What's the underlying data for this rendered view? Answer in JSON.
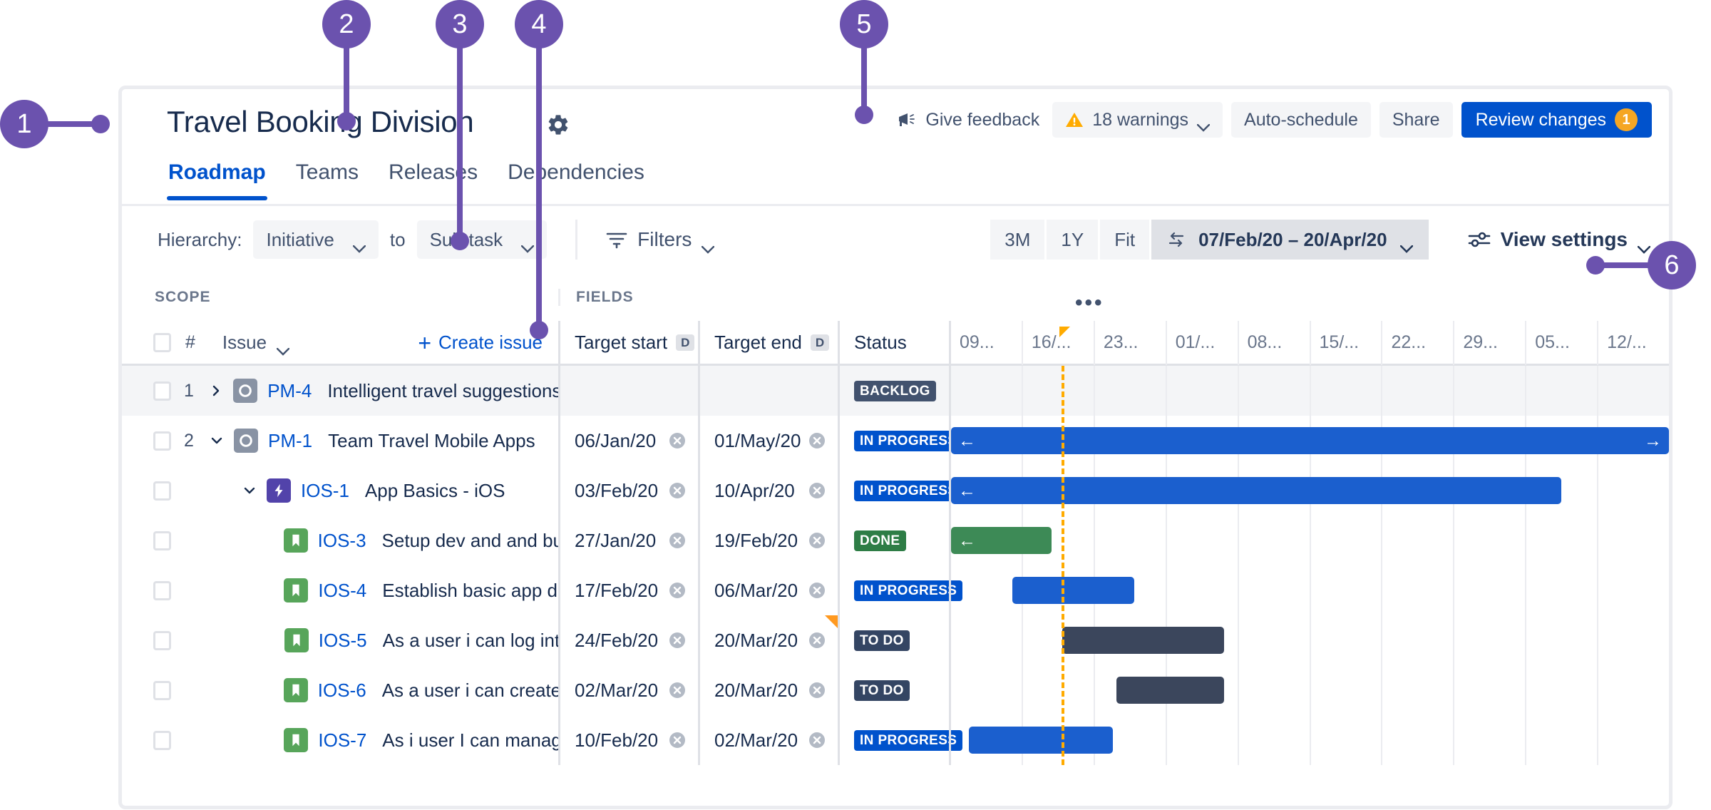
{
  "header": {
    "title": "Travel Booking Division",
    "settings_icon": "gear-icon",
    "give_feedback": "Give feedback",
    "warnings_label": "18 warnings",
    "auto_schedule": "Auto-schedule",
    "share": "Share",
    "review_changes": "Review changes",
    "review_changes_count": "1"
  },
  "tabs": [
    {
      "label": "Roadmap",
      "active": true
    },
    {
      "label": "Teams",
      "active": false
    },
    {
      "label": "Releases",
      "active": false
    },
    {
      "label": "Dependencies",
      "active": false
    }
  ],
  "toolbar": {
    "hierarchy_label": "Hierarchy:",
    "hierarchy_from": "Initiative",
    "hierarchy_to_word": "to",
    "hierarchy_to": "Sub-task",
    "filters_label": "Filters",
    "zoom_3m": "3M",
    "zoom_1y": "1Y",
    "zoom_fit": "Fit",
    "date_range": "07/Feb/20 – 20/Apr/20",
    "view_settings": "View settings"
  },
  "grid": {
    "scope_header": "SCOPE",
    "fields_header": "FIELDS",
    "more_menu": "•••",
    "hash_col": "#",
    "issue_col": "Issue",
    "create_issue": "Create issue",
    "col_target_start": "Target start",
    "col_target_end": "Target end",
    "col_status": "Status",
    "date_field_key": "D"
  },
  "timeline": {
    "ticks": [
      "09...",
      "16/...",
      "23...",
      "01/...",
      "08...",
      "15/...",
      "22...",
      "29...",
      "05...",
      "12/..."
    ],
    "today_tick_index": 1
  },
  "rows": [
    {
      "num": "1",
      "twisty": "right",
      "type": "initiative",
      "key": "PM-4",
      "summary": "Intelligent travel suggestions",
      "target_start": "",
      "target_end": "",
      "status": "BACKLOG",
      "status_class": "lz-backlog",
      "indent": 0,
      "alt": true,
      "bar": null,
      "start_flag": false
    },
    {
      "num": "2",
      "twisty": "down",
      "type": "initiative",
      "key": "PM-1",
      "summary": "Team Travel Mobile Apps",
      "target_start": "06/Jan/20",
      "target_end": "01/May/20",
      "status": "IN PROGRESS",
      "status_class": "lz-progress",
      "indent": 0,
      "alt": false,
      "bar": {
        "left_pct": 0,
        "width_pct": 100,
        "color": "blue",
        "arrow_left": true,
        "arrow_right": true
      },
      "start_flag": false
    },
    {
      "num": "",
      "twisty": "down",
      "type": "epic",
      "key": "IOS-1",
      "summary": "App Basics - iOS",
      "target_start": "03/Feb/20",
      "target_end": "10/Apr/20",
      "status": "IN PROGRESS",
      "status_class": "lz-progress",
      "indent": 1,
      "alt": false,
      "bar": {
        "left_pct": 0,
        "width_pct": 85,
        "color": "blue",
        "arrow_left": true,
        "arrow_right": false
      },
      "start_flag": false
    },
    {
      "num": "",
      "twisty": "none",
      "type": "story",
      "key": "IOS-3",
      "summary": "Setup dev and and build environ...",
      "target_start": "27/Jan/20",
      "target_end": "19/Feb/20",
      "status": "DONE",
      "status_class": "lz-done",
      "indent": 2,
      "alt": false,
      "bar": {
        "left_pct": 0,
        "width_pct": 14,
        "color": "green",
        "arrow_left": true,
        "arrow_right": false
      },
      "start_flag": false
    },
    {
      "num": "",
      "twisty": "none",
      "type": "story",
      "key": "IOS-4",
      "summary": "Establish basic app dev framew...",
      "target_start": "17/Feb/20",
      "target_end": "06/Mar/20",
      "status": "IN PROGRESS",
      "status_class": "lz-progress",
      "indent": 2,
      "alt": false,
      "bar": {
        "left_pct": 8.5,
        "width_pct": 17,
        "color": "blue",
        "arrow_left": false,
        "arrow_right": false
      },
      "start_flag": false
    },
    {
      "num": "",
      "twisty": "none",
      "type": "story",
      "key": "IOS-5",
      "summary": "As a user i can log into the syst...",
      "target_start": "24/Feb/20",
      "target_end": "20/Mar/20",
      "status": "TO DO",
      "status_class": "lz-todo",
      "indent": 2,
      "alt": false,
      "bar": {
        "left_pct": 15.5,
        "width_pct": 22.5,
        "color": "dark",
        "arrow_left": false,
        "arrow_right": false
      },
      "start_flag": true
    },
    {
      "num": "",
      "twisty": "none",
      "type": "story",
      "key": "IOS-6",
      "summary": "As a user i can create a custom ...",
      "target_start": "02/Mar/20",
      "target_end": "20/Mar/20",
      "status": "TO DO",
      "status_class": "lz-todo",
      "indent": 2,
      "alt": false,
      "bar": {
        "left_pct": 23,
        "width_pct": 15,
        "color": "dark",
        "arrow_left": false,
        "arrow_right": false
      },
      "start_flag": false
    },
    {
      "num": "",
      "twisty": "none",
      "type": "story",
      "key": "IOS-7",
      "summary": "As i user I can manage my profile",
      "target_start": "10/Feb/20",
      "target_end": "02/Mar/20",
      "status": "IN PROGRESS",
      "status_class": "lz-progress",
      "indent": 2,
      "alt": false,
      "bar": {
        "left_pct": 2.5,
        "width_pct": 20,
        "color": "blue",
        "arrow_left": false,
        "arrow_right": false
      },
      "start_flag": false
    }
  ],
  "callouts": [
    {
      "n": "1"
    },
    {
      "n": "2"
    },
    {
      "n": "3"
    },
    {
      "n": "4"
    },
    {
      "n": "5"
    },
    {
      "n": "6"
    }
  ],
  "colors": {
    "accent_purple": "#6b52ae",
    "brand_blue": "#0052cc",
    "bar_blue": "#1b5fce",
    "bar_green": "#3d8a56",
    "bar_dark": "#3b465c",
    "today_orange": "#ffab00",
    "warning_orange": "#f5a623"
  }
}
